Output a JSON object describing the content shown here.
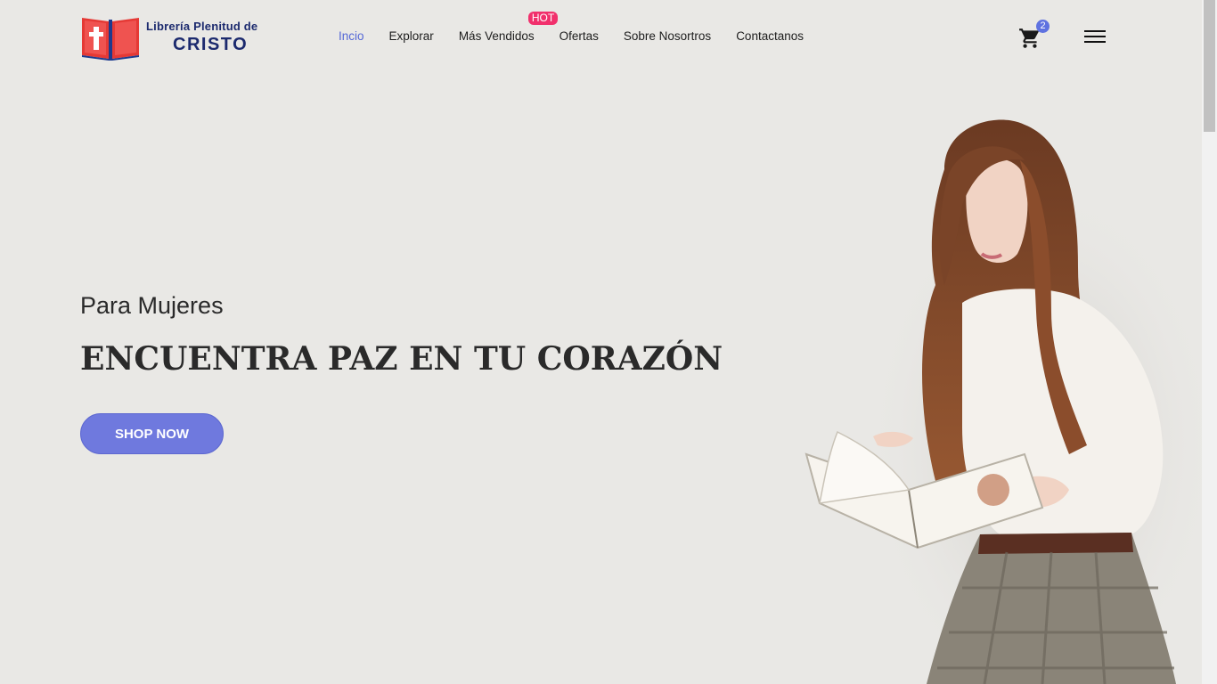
{
  "logo": {
    "line1": "Librería Plenitud de",
    "line2": "CRISTO"
  },
  "nav": {
    "items": [
      {
        "label": "Incio",
        "active": true
      },
      {
        "label": "Explorar"
      },
      {
        "label": "Más Vendidos",
        "badge": "HOT"
      },
      {
        "label": "Ofertas"
      },
      {
        "label": "Sobre Nosortros"
      },
      {
        "label": "Contactanos"
      }
    ]
  },
  "cart": {
    "count": "2",
    "icon": "cart-icon"
  },
  "menu": {
    "icon": "hamburger-menu-icon"
  },
  "hero": {
    "subtitle": "Para Mujeres",
    "headline": "ENCUENTRA PAZ EN TU CORAZÓN",
    "button": "SHOP NOW",
    "image": "woman-reading-book"
  },
  "colors": {
    "accent": "#6f79de",
    "active_nav": "#5568d6",
    "hot_badge": "#f1306c",
    "brand_blue": "#1c2a6e",
    "brand_red": "#e53935",
    "background": "#e9e8e5"
  }
}
